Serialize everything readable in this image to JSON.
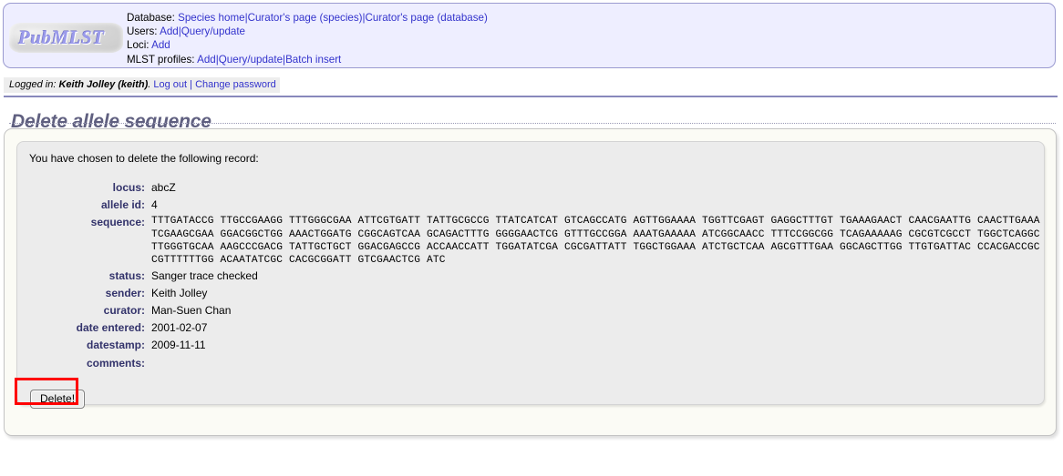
{
  "header": {
    "logo_text": "PubMLST",
    "nav_rows": [
      {
        "label": "Database:",
        "links": [
          "Species home",
          "Curator's page (species)",
          "Curator's page (database)"
        ]
      },
      {
        "label": "Users:",
        "links": [
          "Add",
          "Query/update"
        ]
      },
      {
        "label": "Loci:",
        "links": [
          "Add"
        ]
      },
      {
        "label": "MLST profiles:",
        "links": [
          "Add",
          "Query/update",
          "Batch insert"
        ]
      }
    ],
    "separator": "|"
  },
  "session": {
    "prefix": "Logged in:",
    "user": "Keith Jolley (keith)",
    "period": ".",
    "logout_label": "Log out",
    "separator": "|",
    "change_password_label": "Change password"
  },
  "page": {
    "title": "Delete allele sequence",
    "intro": "You have chosen to delete the following record:"
  },
  "record": {
    "fields": [
      {
        "label": "locus:",
        "value": "abcZ"
      },
      {
        "label": "allele id:",
        "value": "4"
      },
      {
        "label": "status:",
        "value": "Sanger trace checked"
      },
      {
        "label": "sender:",
        "value": "Keith Jolley"
      },
      {
        "label": "curator:",
        "value": "Man-Suen Chan"
      },
      {
        "label": "date entered:",
        "value": "2001-02-07"
      },
      {
        "label": "datestamp:",
        "value": "2009-11-11"
      },
      {
        "label": "comments:",
        "value": ""
      }
    ],
    "sequence_label": "sequence:",
    "sequence_lines": [
      "TTTGATACCG TTGCCGAAGG TTTGGGCGAA ATTCGTGATT TATTGCGCCG TTATCATCAT GTCAGCCATG AGTTGGAAAA TGGTTCGAGT GAGGCTTTGT TGAAAGAACT CAACGAATTG CAACTTGAAA",
      "TCGAAGCGAA GGACGGCTGG AAACTGGATG CGGCAGTCAA GCAGACTTTG GGGGAACTCG GTTTGCCGGA AAATGAAAAA ATCGGCAACC TTTCCGGCGG TCAGAAAAAG CGCGTCGCCT TGGCTCAGGC",
      "TTGGGTGCAA AAGCCCGACG TATTGCTGCT GGACGAGCCG ACCAACCATT TGGATATCGA CGCGATTATT TGGCTGGAAA ATCTGCTCAA AGCGTTTGAA GGCAGCTTGG TTGTGATTAC CCACGACCGC",
      "CGTTTTTTGG ACAATATCGC CACGCGGATT GTCGAACTCG ATC"
    ]
  },
  "actions": {
    "delete_label": "Delete!"
  },
  "colors": {
    "link": "#3333cc",
    "header_bg": "#eeeeff",
    "header_border": "#9a9ad0",
    "title": "#606080",
    "field_label": "#33336b",
    "annotation": "#ff0000",
    "panel_bg": "#fbfbf5",
    "record_bg": "#ececec"
  }
}
